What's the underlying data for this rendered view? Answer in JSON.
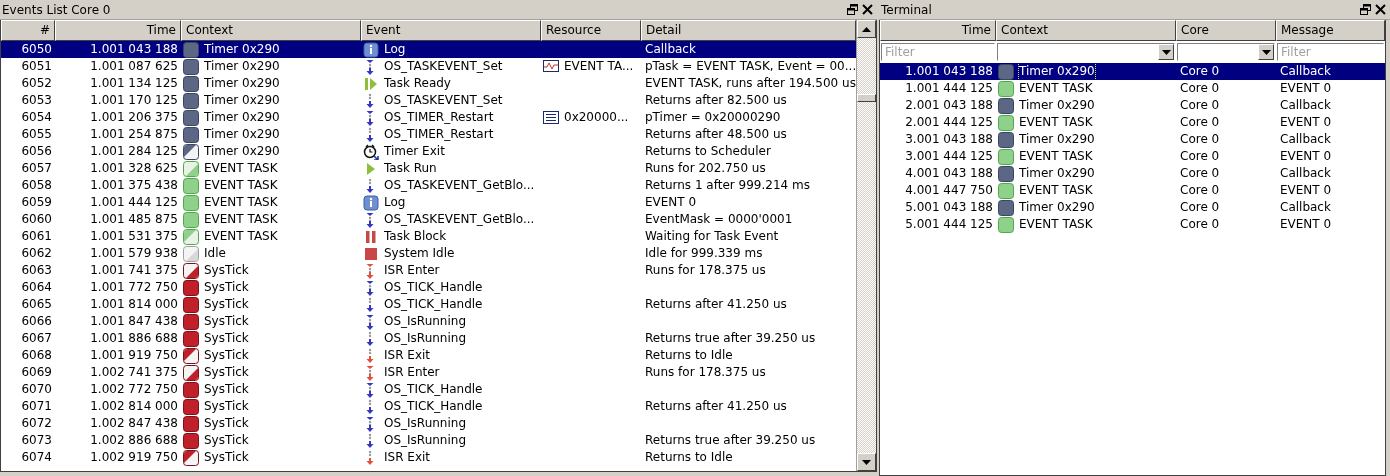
{
  "events_panel": {
    "title": "Events List Core 0",
    "columns": [
      "#",
      "Time",
      "Context",
      "Event",
      "Resource",
      "Detail"
    ],
    "rows": [
      {
        "number": "6050",
        "time": "1.001 043 188",
        "context": {
          "kind": "timer",
          "name": "Timer 0x290"
        },
        "event": {
          "kind": "log",
          "name": "Log"
        },
        "detail": "Callback",
        "selected": true
      },
      {
        "number": "6051",
        "time": "1.001 087 625",
        "context": {
          "kind": "timer",
          "name": "Timer 0x290"
        },
        "event": {
          "kind": "call",
          "name": "OS_TASKEVENT_Set"
        },
        "resource": {
          "kind": "event",
          "text": "EVENT TA..."
        },
        "detail": "pTask = EVENT TASK, Event = 00...",
        "selected": false
      },
      {
        "number": "6052",
        "time": "1.001 134 125",
        "context": {
          "kind": "timer",
          "name": "Timer 0x290"
        },
        "event": {
          "kind": "task-ready",
          "name": "Task Ready"
        },
        "detail": "EVENT TASK, runs after 194.500 us",
        "selected": false
      },
      {
        "number": "6053",
        "time": "1.001 170 125",
        "context": {
          "kind": "timer",
          "name": "Timer 0x290"
        },
        "event": {
          "kind": "return",
          "name": "OS_TASKEVENT_Set"
        },
        "detail": "Returns after 82.500 us",
        "selected": false
      },
      {
        "number": "6054",
        "time": "1.001 206 375",
        "context": {
          "kind": "timer",
          "name": "Timer 0x290"
        },
        "event": {
          "kind": "call",
          "name": "OS_TIMER_Restart"
        },
        "resource": {
          "kind": "list",
          "text": "0x20000..."
        },
        "detail": "pTimer = 0x20000290",
        "selected": false
      },
      {
        "number": "6055",
        "time": "1.001 254 875",
        "context": {
          "kind": "timer",
          "name": "Timer 0x290"
        },
        "event": {
          "kind": "return",
          "name": "OS_TIMER_Restart"
        },
        "detail": "Returns after 48.500 us",
        "selected": false
      },
      {
        "number": "6056",
        "time": "1.001 284 125",
        "context": {
          "kind": "timer-stop",
          "name": "Timer 0x290"
        },
        "event": {
          "kind": "timer-exit",
          "name": "Timer Exit"
        },
        "detail": "Returns to Scheduler",
        "selected": false
      },
      {
        "number": "6057",
        "time": "1.001 328 625",
        "context": {
          "kind": "task-start",
          "name": "EVENT TASK"
        },
        "event": {
          "kind": "task-run",
          "name": "Task Run"
        },
        "detail": "Runs for 202.750 us",
        "selected": false
      },
      {
        "number": "6058",
        "time": "1.001 375 438",
        "context": {
          "kind": "task",
          "name": "EVENT TASK"
        },
        "event": {
          "kind": "return",
          "name": "OS_TASKEVENT_GetBlo..."
        },
        "detail": "Returns 1 after 999.214 ms",
        "selected": false
      },
      {
        "number": "6059",
        "time": "1.001 444 125",
        "context": {
          "kind": "task",
          "name": "EVENT TASK"
        },
        "event": {
          "kind": "log",
          "name": "Log"
        },
        "detail": "EVENT 0",
        "selected": false
      },
      {
        "number": "6060",
        "time": "1.001 485 875",
        "context": {
          "kind": "task",
          "name": "EVENT TASK"
        },
        "event": {
          "kind": "call",
          "name": "OS_TASKEVENT_GetBlo..."
        },
        "detail": "EventMask = 0000'0001",
        "selected": false
      },
      {
        "number": "6061",
        "time": "1.001 531 375",
        "context": {
          "kind": "task-stop",
          "name": "EVENT TASK"
        },
        "event": {
          "kind": "task-block",
          "name": "Task Block"
        },
        "detail": "Waiting for Task Event",
        "selected": false
      },
      {
        "number": "6062",
        "time": "1.001 579 938",
        "context": {
          "kind": "idle",
          "name": "Idle"
        },
        "event": {
          "kind": "system-idle",
          "name": "System Idle"
        },
        "detail": "Idle for 999.339 ms",
        "selected": false
      },
      {
        "number": "6063",
        "time": "1.001 741 375",
        "context": {
          "kind": "isr-start",
          "name": "SysTick"
        },
        "event": {
          "kind": "isr-enter",
          "name": "ISR Enter"
        },
        "detail": "Runs for 178.375 us",
        "selected": false
      },
      {
        "number": "6064",
        "time": "1.001 772 750",
        "context": {
          "kind": "isr",
          "name": "SysTick"
        },
        "event": {
          "kind": "call",
          "name": "OS_TICK_Handle"
        },
        "selected": false
      },
      {
        "number": "6065",
        "time": "1.001 814 000",
        "context": {
          "kind": "isr",
          "name": "SysTick"
        },
        "event": {
          "kind": "return",
          "name": "OS_TICK_Handle"
        },
        "detail": "Returns after 41.250 us",
        "selected": false
      },
      {
        "number": "6066",
        "time": "1.001 847 438",
        "context": {
          "kind": "isr",
          "name": "SysTick"
        },
        "event": {
          "kind": "call",
          "name": "OS_IsRunning"
        },
        "selected": false
      },
      {
        "number": "6067",
        "time": "1.001 886 688",
        "context": {
          "kind": "isr",
          "name": "SysTick"
        },
        "event": {
          "kind": "return",
          "name": "OS_IsRunning"
        },
        "detail": "Returns true after 39.250 us",
        "selected": false
      },
      {
        "number": "6068",
        "time": "1.001 919 750",
        "context": {
          "kind": "isr-stop",
          "name": "SysTick"
        },
        "event": {
          "kind": "isr-exit",
          "name": "ISR Exit"
        },
        "detail": "Returns to Idle",
        "selected": false
      },
      {
        "number": "6069",
        "time": "1.002 741 375",
        "context": {
          "kind": "isr-start",
          "name": "SysTick"
        },
        "event": {
          "kind": "isr-enter",
          "name": "ISR Enter"
        },
        "detail": "Runs for 178.375 us",
        "selected": false
      },
      {
        "number": "6070",
        "time": "1.002 772 750",
        "context": {
          "kind": "isr",
          "name": "SysTick"
        },
        "event": {
          "kind": "call",
          "name": "OS_TICK_Handle"
        },
        "selected": false
      },
      {
        "number": "6071",
        "time": "1.002 814 000",
        "context": {
          "kind": "isr",
          "name": "SysTick"
        },
        "event": {
          "kind": "return",
          "name": "OS_TICK_Handle"
        },
        "detail": "Returns after 41.250 us",
        "selected": false
      },
      {
        "number": "6072",
        "time": "1.002 847 438",
        "context": {
          "kind": "isr",
          "name": "SysTick"
        },
        "event": {
          "kind": "call",
          "name": "OS_IsRunning"
        },
        "selected": false
      },
      {
        "number": "6073",
        "time": "1.002 886 688",
        "context": {
          "kind": "isr",
          "name": "SysTick"
        },
        "event": {
          "kind": "return",
          "name": "OS_IsRunning"
        },
        "detail": "Returns true after 39.250 us",
        "selected": false
      },
      {
        "number": "6074",
        "time": "1.002 919 750",
        "context": {
          "kind": "isr-stop",
          "name": "SysTick"
        },
        "event": {
          "kind": "isr-exit",
          "name": "ISR Exit"
        },
        "detail": "Returns to Idle",
        "selected": false
      }
    ]
  },
  "terminal_panel": {
    "title": "Terminal",
    "columns": [
      "Time",
      "Context",
      "Core",
      "Message"
    ],
    "filters": [
      {
        "kind": "text",
        "placeholder": "Filter"
      },
      {
        "kind": "dropdown"
      },
      {
        "kind": "dropdown"
      },
      {
        "kind": "text",
        "placeholder": "Filter"
      }
    ],
    "rows": [
      {
        "time": "1.001 043 188",
        "context": {
          "kind": "timer",
          "name": "Timer 0x290"
        },
        "core": "Core 0",
        "message": "Callback",
        "selected": true
      },
      {
        "time": "1.001 444 125",
        "context": {
          "kind": "task",
          "name": "EVENT TASK"
        },
        "core": "Core 0",
        "message": "EVENT 0",
        "selected": false
      },
      {
        "time": "2.001 043 188",
        "context": {
          "kind": "timer",
          "name": "Timer 0x290"
        },
        "core": "Core 0",
        "message": "Callback",
        "selected": false
      },
      {
        "time": "2.001 444 125",
        "context": {
          "kind": "task",
          "name": "EVENT TASK"
        },
        "core": "Core 0",
        "message": "EVENT 0",
        "selected": false
      },
      {
        "time": "3.001 043 188",
        "context": {
          "kind": "timer",
          "name": "Timer 0x290"
        },
        "core": "Core 0",
        "message": "Callback",
        "selected": false
      },
      {
        "time": "3.001 444 125",
        "context": {
          "kind": "task",
          "name": "EVENT TASK"
        },
        "core": "Core 0",
        "message": "EVENT 0",
        "selected": false
      },
      {
        "time": "4.001 043 188",
        "context": {
          "kind": "timer",
          "name": "Timer 0x290"
        },
        "core": "Core 0",
        "message": "Callback",
        "selected": false
      },
      {
        "time": "4.001 447 750",
        "context": {
          "kind": "task",
          "name": "EVENT TASK"
        },
        "core": "Core 0",
        "message": "EVENT 0",
        "selected": false
      },
      {
        "time": "5.001 043 188",
        "context": {
          "kind": "timer",
          "name": "Timer 0x290"
        },
        "core": "Core 0",
        "message": "Callback",
        "selected": false
      },
      {
        "time": "5.001 444 125",
        "context": {
          "kind": "task",
          "name": "EVENT TASK"
        },
        "core": "Core 0",
        "message": "EVENT 0",
        "selected": false
      }
    ]
  }
}
